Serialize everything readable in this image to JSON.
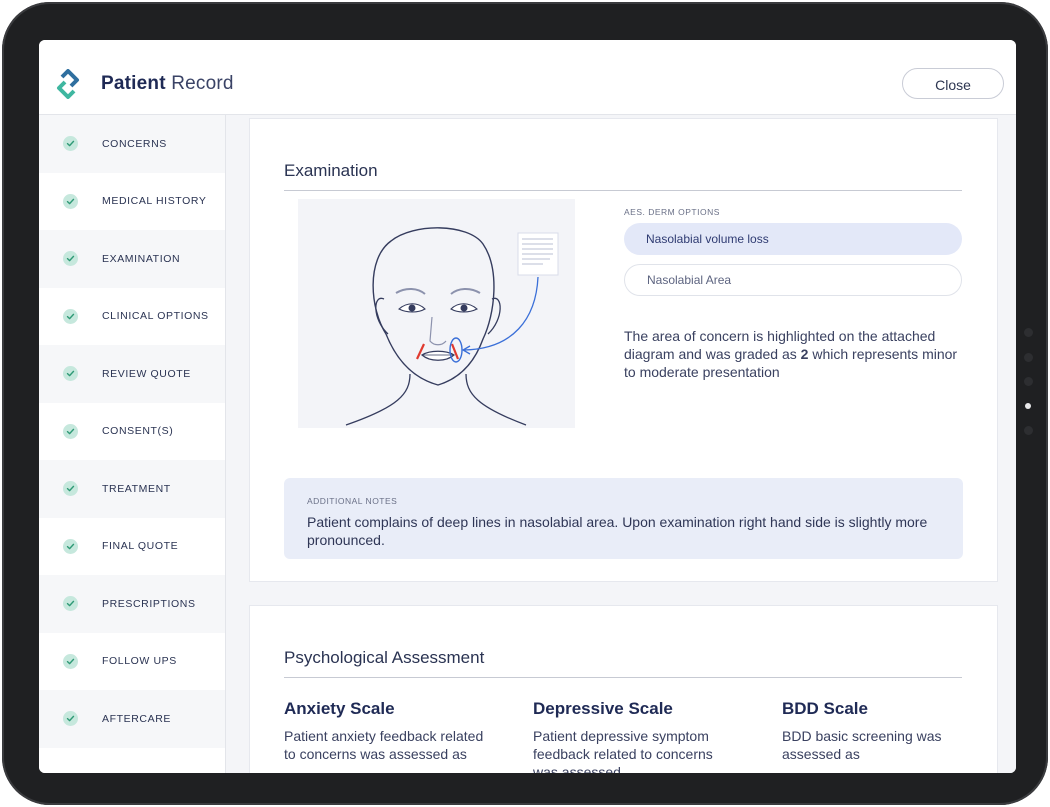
{
  "header": {
    "brand_bold": "Patient",
    "brand_light": "Record",
    "close_label": "Close"
  },
  "sidebar": {
    "items": [
      {
        "label": "CONCERNS"
      },
      {
        "label": "MEDICAL HISTORY"
      },
      {
        "label": "EXAMINATION"
      },
      {
        "label": "CLINICAL OPTIONS"
      },
      {
        "label": "REVIEW QUOTE"
      },
      {
        "label": "CONSENT(S)"
      },
      {
        "label": "TREATMENT"
      },
      {
        "label": "FINAL QUOTE"
      },
      {
        "label": "PRESCRIPTIONS"
      },
      {
        "label": "FOLLOW UPS"
      },
      {
        "label": "AFTERCARE"
      }
    ]
  },
  "examination": {
    "title": "Examination",
    "options_caption": "AES. DERM OPTIONS",
    "options": [
      {
        "label": "Nasolabial volume loss",
        "selected": true
      },
      {
        "label": "Nasolabial Area",
        "selected": false
      }
    ],
    "description_pre": "The area of concern is highlighted on the attached diagram and was graded as ",
    "grade": "2",
    "description_post": " which represents minor to moderate presentation",
    "notes_caption": "ADDITIONAL NOTES",
    "notes_text": "Patient complains of deep lines in nasolabial area. Upon examination right hand side is slightly more pronounced."
  },
  "psych": {
    "title": "Psychological Assessment",
    "scales": [
      {
        "title": "Anxiety Scale",
        "text": "Patient anxiety feedback related to concerns was assessed as"
      },
      {
        "title": "Depressive Scale",
        "text": "Patient depressive symptom feedback related to concerns was assessed"
      },
      {
        "title": "BDD Scale",
        "text": "BDD basic screening was assessed as"
      }
    ]
  },
  "colors": {
    "accent": "#2f6f9f",
    "check_bg": "#c6e8dd",
    "check_mark": "#2f9a76",
    "selected_pill": "#e3e8f8",
    "highlight_red": "#e03a2f",
    "highlight_blue": "#3a6fd8"
  }
}
